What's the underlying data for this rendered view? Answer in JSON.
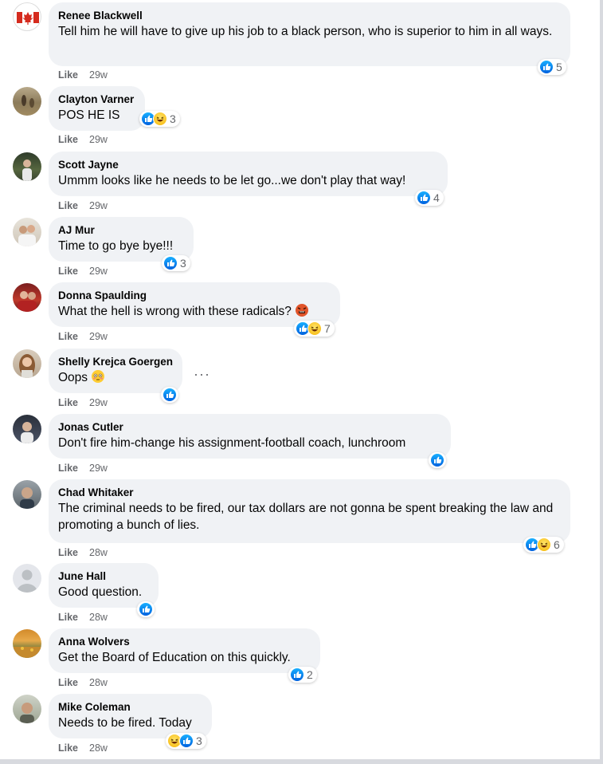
{
  "comments": [
    {
      "author": "Renee Blackwell",
      "text": "Tell him he will have to give up his job to a black person, who is superior to him in all ways.",
      "like_label": "Like",
      "time": "29w",
      "reaction_count": "5",
      "reactions": [
        "like-icon"
      ]
    },
    {
      "author": "Clayton Varner",
      "text": "POS HE IS",
      "like_label": "Like",
      "time": "29w",
      "reaction_count": "3",
      "reactions": [
        "like-icon",
        "haha-icon"
      ]
    },
    {
      "author": "Scott Jayne",
      "text": "Ummm looks like he needs to be let go...we don't play that way!",
      "like_label": "Like",
      "time": "29w",
      "reaction_count": "4",
      "reactions": [
        "like-icon"
      ]
    },
    {
      "author": "AJ Mur",
      "text": "Time to go bye bye!!!",
      "like_label": "Like",
      "time": "29w",
      "reaction_count": "3",
      "reactions": [
        "like-icon"
      ]
    },
    {
      "author": "Donna Spaulding",
      "text": "What the hell is wrong with these radicals?",
      "emoji": "angry-face-emoji",
      "like_label": "Like",
      "time": "29w",
      "reaction_count": "7",
      "reactions": [
        "like-icon",
        "haha-icon"
      ]
    },
    {
      "author": "Shelly Krejca Goergen",
      "text": "Oops",
      "emoji": "flushed-face-emoji",
      "like_label": "Like",
      "time": "29w",
      "reaction_count": "",
      "reactions": [
        "like-icon"
      ],
      "more_label": "···"
    },
    {
      "author": "Jonas Cutler",
      "text": "Don't fire him-change his assignment-football coach, lunchroom",
      "like_label": "Like",
      "time": "29w",
      "reaction_count": "",
      "reactions": [
        "like-icon"
      ]
    },
    {
      "author": "Chad Whitaker",
      "text": "The criminal needs to be fired, our tax dollars are not gonna be spent breaking the law and promoting a bunch of lies.",
      "like_label": "Like",
      "time": "28w",
      "reaction_count": "6",
      "reactions": [
        "like-icon",
        "haha-icon"
      ]
    },
    {
      "author": "June Hall",
      "text": "Good question.",
      "like_label": "Like",
      "time": "28w",
      "reaction_count": "",
      "reactions": [
        "like-icon"
      ]
    },
    {
      "author": "Anna Wolvers",
      "text": "Get the Board of Education on this quickly.",
      "like_label": "Like",
      "time": "28w",
      "reaction_count": "2",
      "reactions": [
        "like-icon"
      ]
    },
    {
      "author": "Mike Coleman",
      "text": "Needs to be fired. Today",
      "like_label": "Like",
      "time": "28w",
      "reaction_count": "3",
      "reactions": [
        "haha-icon",
        "like-icon"
      ]
    }
  ],
  "colors": {
    "like_blue": "#0866ff",
    "bubble_bg": "#f0f2f5",
    "meta_grey": "#65676b"
  }
}
